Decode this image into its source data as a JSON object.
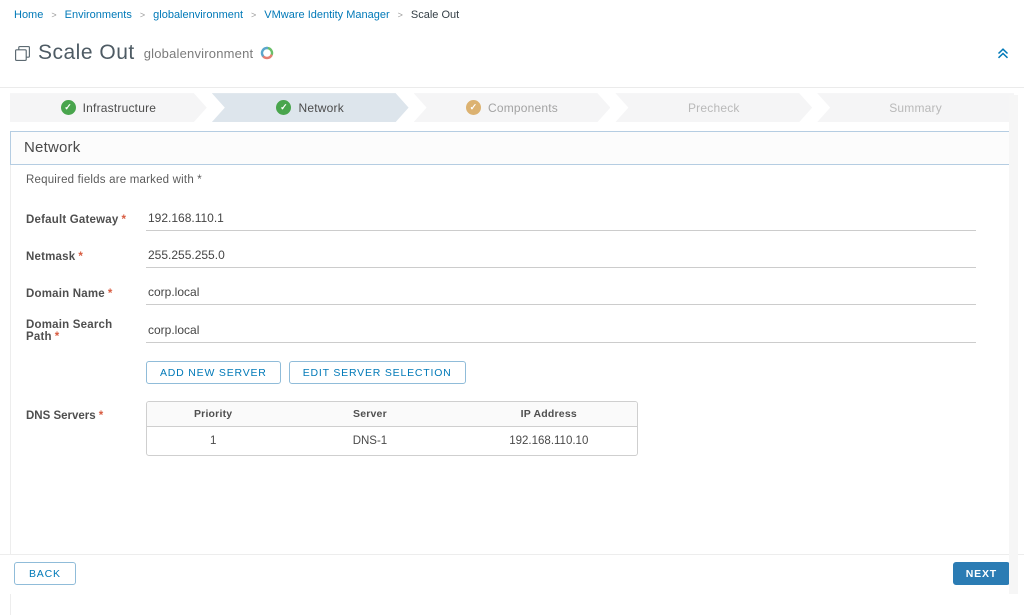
{
  "breadcrumb": {
    "separator": ">",
    "items": [
      "Home",
      "Environments",
      "globalenvironment",
      "VMware Identity Manager",
      "Scale Out"
    ]
  },
  "header": {
    "title": "Scale Out",
    "environment": "globalenvironment"
  },
  "stepper": {
    "steps": [
      {
        "label": "Infrastructure",
        "state": "complete"
      },
      {
        "label": "Network",
        "state": "complete-active"
      },
      {
        "label": "Components",
        "state": "in-progress"
      },
      {
        "label": "Precheck",
        "state": "pending"
      },
      {
        "label": "Summary",
        "state": "pending"
      }
    ]
  },
  "section": {
    "title": "Network",
    "required_note": "Required fields are marked with *"
  },
  "required_marker": "*",
  "form": {
    "fields": [
      {
        "label": "Default Gateway",
        "value": "192.168.110.1",
        "required": true
      },
      {
        "label": "Netmask",
        "value": "255.255.255.0",
        "required": true
      },
      {
        "label": "Domain Name",
        "value": "corp.local",
        "required": true
      },
      {
        "label": "Domain Search Path",
        "value": "corp.local",
        "required": true
      }
    ]
  },
  "server_actions": {
    "add": "ADD NEW SERVER",
    "edit": "EDIT SERVER SELECTION"
  },
  "dns": {
    "label": "DNS Servers",
    "columns": [
      "Priority",
      "Server",
      "IP Address"
    ],
    "rows": [
      [
        "1",
        "DNS-1",
        "192.168.110.10"
      ]
    ]
  },
  "footer": {
    "back": "BACK",
    "next": "NEXT"
  },
  "icons": {
    "title": "clone-squares-icon",
    "env_status": "environment-status-spinner-icon",
    "collapse": "double-chevron-up-icon",
    "step_complete": "green-check-icon",
    "step_in_progress": "tan-check-icon"
  },
  "colors": {
    "link": "#0079b8",
    "success": "#49a54d",
    "warning": "#dcb271",
    "step_active_bg": "#dde5ec",
    "step_bg": "#f5f5f6",
    "primary_button": "#2b7cb4",
    "required": "#d85c41",
    "section_border": "#b5cde2"
  }
}
